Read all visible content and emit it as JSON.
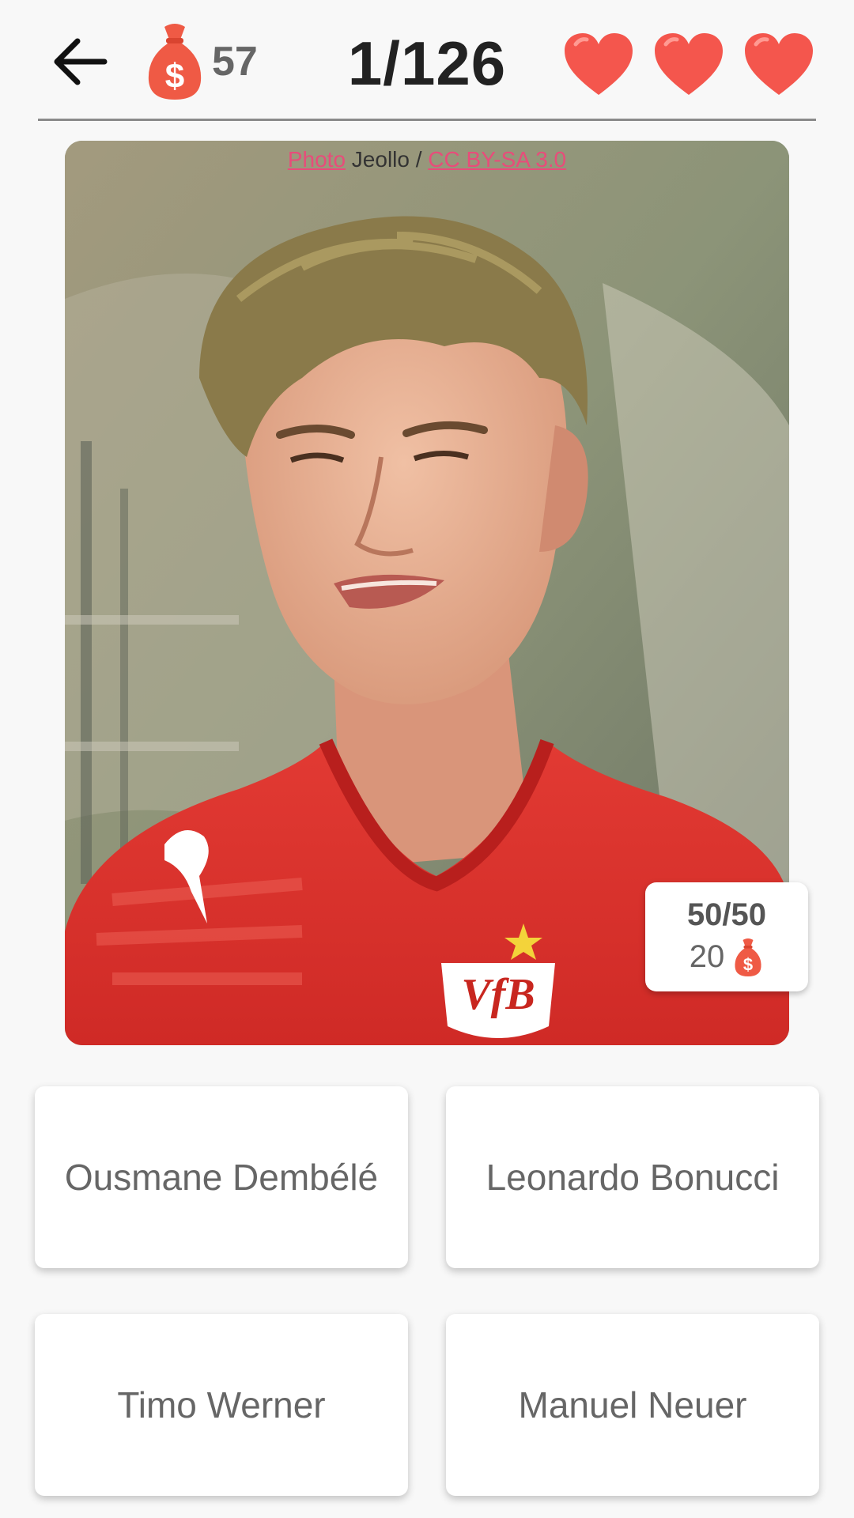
{
  "header": {
    "back_icon": "arrow-left-icon",
    "coin_icon": "money-bag-icon",
    "coins": "57",
    "progress": "1/126",
    "lives_icon": "heart-icon",
    "lives": 3
  },
  "photo": {
    "credit_link1": "Photo",
    "credit_author": " Jeollo / ",
    "credit_link2": "CC BY-SA 3.0"
  },
  "hint": {
    "label": "50/50",
    "cost": "20"
  },
  "answers": [
    {
      "label": "Ousmane Dembélé"
    },
    {
      "label": "Leonardo Bonucci"
    },
    {
      "label": "Timo Werner"
    },
    {
      "label": "Manuel Neuer"
    }
  ],
  "colors": {
    "heart": "#f4564d",
    "bag": "#ef5a45",
    "link": "#e84c7a"
  }
}
